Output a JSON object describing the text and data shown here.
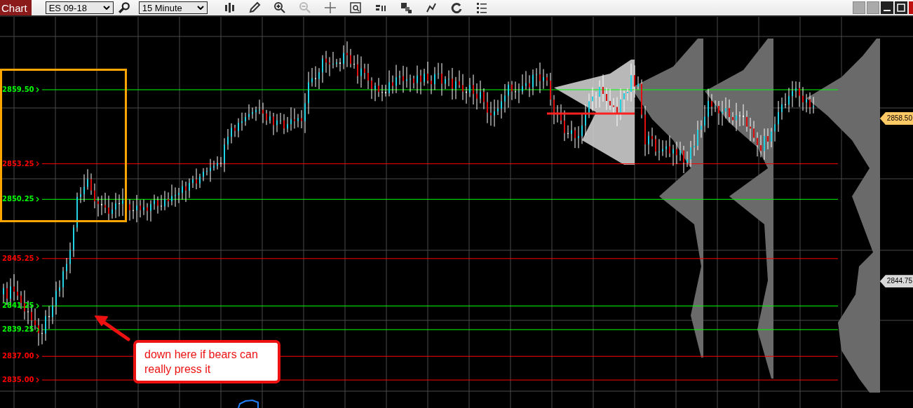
{
  "toolbar": {
    "tab": "Chart",
    "symbol": "ES 09-18",
    "interval": "15 Minute",
    "tools": [
      {
        "kind": "bars",
        "disabled": false
      },
      {
        "kind": "pencil",
        "disabled": false
      },
      {
        "kind": "zoom-in",
        "disabled": false
      },
      {
        "kind": "zoom-out",
        "disabled": true
      },
      {
        "kind": "crosshair",
        "disabled": false
      },
      {
        "kind": "report",
        "disabled": false
      },
      {
        "kind": "volume",
        "disabled": false
      },
      {
        "kind": "squares",
        "disabled": false
      },
      {
        "kind": "nodes",
        "disabled": false
      },
      {
        "kind": "refresh",
        "disabled": false
      },
      {
        "kind": "list",
        "disabled": false
      }
    ]
  },
  "chart": {
    "levels": [
      {
        "label": "2859.50",
        "color": "#00ff00"
      },
      {
        "label": "2853.25",
        "color": "#ff0000"
      },
      {
        "label": "2850.25",
        "color": "#00ff00"
      },
      {
        "label": "2845.25",
        "color": "#ff0000"
      },
      {
        "label": "2841.25",
        "color": "#00ff00"
      },
      {
        "label": "2839.25",
        "color": "#00ff00"
      },
      {
        "label": "2837.00",
        "color": "#ff0000"
      },
      {
        "label": "2835.00",
        "color": "#ff0000"
      }
    ],
    "price_tags": [
      {
        "label": "2858.50",
        "color": "#ffc966"
      },
      {
        "label": "2844.75",
        "color": "#d8d8d8"
      }
    ],
    "callout": {
      "text": "down here if bears can really press it"
    }
  }
}
